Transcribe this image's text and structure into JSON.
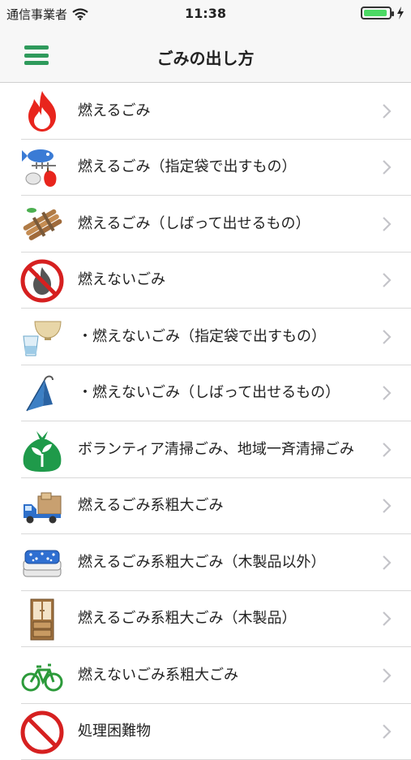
{
  "status": {
    "carrier": "通信事業者",
    "time": "11:38"
  },
  "header": {
    "title": "ごみの出し方"
  },
  "items": [
    {
      "label": "燃えるごみ",
      "icon": "fire-icon"
    },
    {
      "label": "燃えるごみ（指定袋で出すもの）",
      "icon": "kitchen-waste-icon"
    },
    {
      "label": "燃えるごみ（しばって出せるもの）",
      "icon": "bundled-branches-icon"
    },
    {
      "label": "燃えないごみ",
      "icon": "no-fire-icon"
    },
    {
      "label": "・燃えないごみ（指定袋で出すもの）",
      "icon": "bowl-cup-icon"
    },
    {
      "label": "・燃えないごみ（しばって出せるもの）",
      "icon": "umbrella-icon"
    },
    {
      "label": "ボランティア清掃ごみ、地域一斉清掃ごみ",
      "icon": "green-bag-icon"
    },
    {
      "label": "燃えるごみ系粗大ごみ",
      "icon": "truck-icon"
    },
    {
      "label": "燃えるごみ系粗大ごみ（木製品以外）",
      "icon": "futon-icon"
    },
    {
      "label": "燃えるごみ系粗大ごみ（木製品）",
      "icon": "wardrobe-icon"
    },
    {
      "label": "燃えないごみ系粗大ごみ",
      "icon": "bicycle-icon"
    },
    {
      "label": "処理困難物",
      "icon": "prohibited-icon"
    }
  ]
}
